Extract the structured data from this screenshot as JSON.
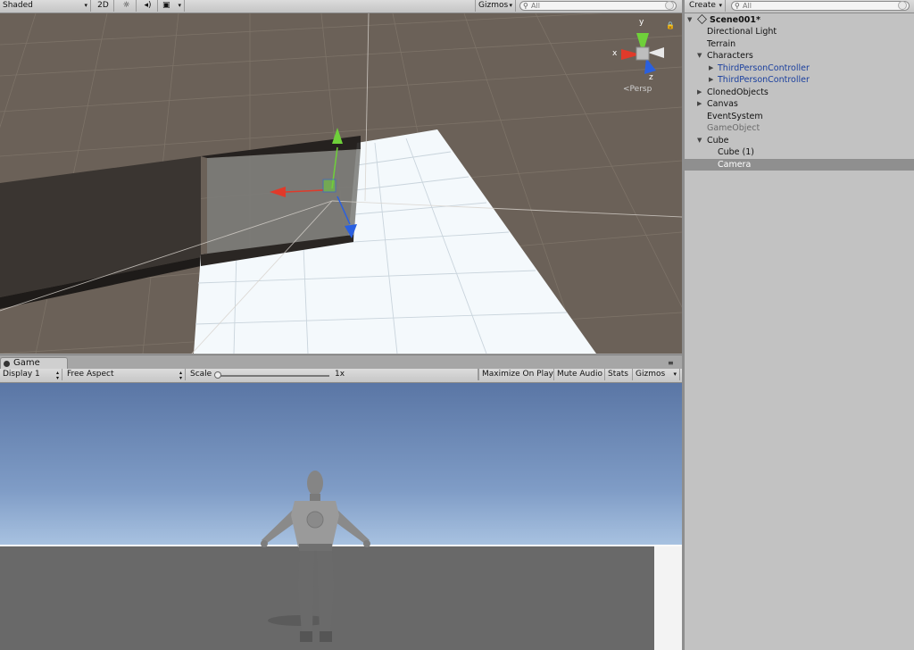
{
  "scene_toolbar": {
    "shading_mode": "Shaded",
    "mode_2d": "2D",
    "light_icon": "sun-icon",
    "audio_icon": "speaker-icon",
    "effects_icon": "image-icon",
    "gizmos_label": "Gizmos",
    "search_placeholder": "All"
  },
  "scene_view": {
    "axis_labels": {
      "x": "x",
      "y": "y",
      "z": "z"
    },
    "projection_label": "Persp",
    "colors": {
      "background": "#6b6158",
      "ground": "#f4f9fc",
      "x_axis": "#e03a2a",
      "y_axis": "#6fd03a",
      "z_axis": "#2a60e0"
    }
  },
  "game": {
    "tab_label": "Game",
    "display": "Display 1",
    "aspect": "Free Aspect",
    "scale_label": "Scale",
    "scale_value": "1x",
    "maximize_on_play": "Maximize On Play",
    "mute_audio": "Mute Audio",
    "stats": "Stats",
    "gizmos": "Gizmos"
  },
  "hierarchy": {
    "create_label": "Create",
    "search_placeholder": "All",
    "scene_name": "Scene001*",
    "items": [
      {
        "label": "Directional Light"
      },
      {
        "label": "Terrain"
      },
      {
        "label": "Characters"
      },
      {
        "label": "ThirdPersonController"
      },
      {
        "label": "ThirdPersonController"
      },
      {
        "label": "ClonedObjects"
      },
      {
        "label": "Canvas"
      },
      {
        "label": "EventSystem"
      },
      {
        "label": "GameObject"
      },
      {
        "label": "Cube"
      },
      {
        "label": "Cube (1)"
      },
      {
        "label": "Camera"
      }
    ]
  }
}
